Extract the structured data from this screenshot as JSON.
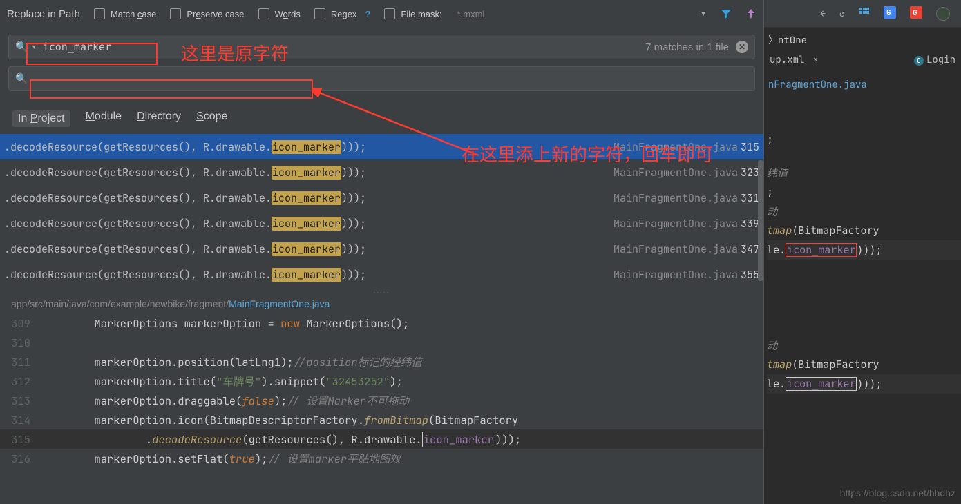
{
  "title": "Replace in Path",
  "checkboxes": {
    "matchCase": "Match case",
    "preserveCase": "Preserve case",
    "words": "Words",
    "regex": "Regex",
    "fileMask": "File mask:"
  },
  "fileMaskValue": "*.mxml",
  "search": {
    "value": "icon_marker",
    "matchInfo": "7 matches in 1 file"
  },
  "replace": {
    "value": ""
  },
  "annotations": {
    "originalHint": "这里是原字符",
    "newHint": "在这里添上新的字符，回车即可"
  },
  "scopes": {
    "inProject": "In Project",
    "module": "Module",
    "directory": "Directory",
    "scope": "Scope"
  },
  "results": [
    {
      "prefix": ".decodeResource(getResources(), R.drawable.",
      "match": "icon_marker",
      "suffix": ")));",
      "file": "MainFragmentOne.java",
      "line": "315",
      "selected": true
    },
    {
      "prefix": ".decodeResource(getResources(), R.drawable.",
      "match": "icon_marker",
      "suffix": ")));",
      "file": "MainFragmentOne.java",
      "line": "323",
      "selected": false
    },
    {
      "prefix": ".decodeResource(getResources(), R.drawable.",
      "match": "icon_marker",
      "suffix": ")));",
      "file": "MainFragmentOne.java",
      "line": "331",
      "selected": false
    },
    {
      "prefix": ".decodeResource(getResources(), R.drawable.",
      "match": "icon_marker",
      "suffix": ")));",
      "file": "MainFragmentOne.java",
      "line": "339",
      "selected": false
    },
    {
      "prefix": ".decodeResource(getResources(), R.drawable.",
      "match": "icon_marker",
      "suffix": ")));",
      "file": "MainFragmentOne.java",
      "line": "347",
      "selected": false
    },
    {
      "prefix": ".decodeResource(getResources(), R.drawable.",
      "match": "icon_marker",
      "suffix": ")));",
      "file": "MainFragmentOne.java",
      "line": "355",
      "selected": false
    }
  ],
  "breadcrumb": {
    "path": "app/src/main/java/com/example/newbike/fragment/",
    "file": "MainFragmentOne.java"
  },
  "editorLines": {
    "l309": "309",
    "l310": "310",
    "l311": "311",
    "l312": "312",
    "l313": "313",
    "l314": "314",
    "l315": "315",
    "l316": "316"
  },
  "code": {
    "l309a": "MarkerOptions markerOption = ",
    "l309new": "new",
    "l309b": " MarkerOptions();",
    "l311a": "markerOption.position(latLng1);",
    "l311c": "//position标记的经纬值",
    "l312a": "markerOption.title(",
    "l312s1": "\"车牌号\"",
    "l312b": ").snippet(",
    "l312s2": "\"32453252\"",
    "l312c": ");",
    "l313a": "markerOption.draggable(",
    "l313f": "false",
    "l313b": ");",
    "l313c": "// 设置Marker不可拖动",
    "l314a": "markerOption.icon(BitmapDescriptorFactory.",
    "l314m": "fromBitmap",
    "l314b": "(BitmapFactory",
    "l315a": "        .",
    "l315m": "decodeResource",
    "l315b": "(getResources(), R.drawable.",
    "l315id": "icon_marker",
    "l315c": ")));",
    "l316a": "markerOption.setFlat(",
    "l316t": "true",
    "l316b": ");",
    "l316c": "// 设置marker平贴地图效"
  },
  "right": {
    "crumb": "ntOne",
    "tab1": "up.xml",
    "tab2": "Login",
    "crumb2": "nFragmentOne.java",
    "frag1": ";",
    "frag2": "纬值",
    "frag3": ";",
    "frag4": "动",
    "frag5a": "tmap",
    "frag5b": "(BitmapFactory",
    "frag6a": "le.",
    "frag6b": "icon_marker",
    "frag6c": ")));",
    "frag7": "动",
    "frag8a": "tmap",
    "frag8b": "(BitmapFactory",
    "frag9a": "le.",
    "frag9b": "icon_marker",
    "frag9c": ")));"
  },
  "watermark": "https://blog.csdn.net/hhdhz"
}
